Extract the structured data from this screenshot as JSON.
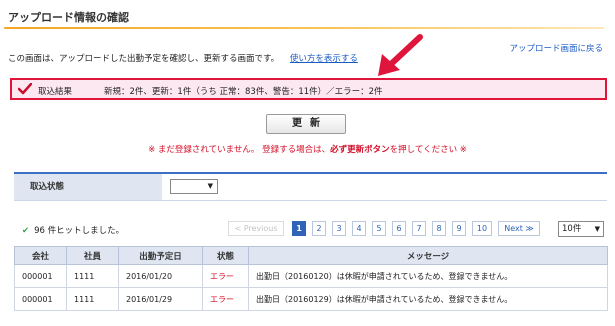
{
  "page": {
    "title": "アップロード情報の確認",
    "back_link": "アップロード画面に戻る",
    "intro_text": "この画面は、アップロードした出勤予定を確認し、更新する画面です。",
    "help_link": "使い方を表示する"
  },
  "result": {
    "label": "取込結果",
    "summary": "新規：2件、更新：1件（うち 正常：83件、警告：11件）／エラー：2件"
  },
  "actions": {
    "update_label": "更新"
  },
  "warning": {
    "prefix": "※ まだ登録されていません。 登録する場合は、",
    "emphasis": "必ず更新ボタン",
    "suffix": "を押してください ※"
  },
  "filter": {
    "label": "取込状態",
    "selected": ""
  },
  "listing": {
    "hit_count": "96 件ヒットしました。",
    "pager": {
      "previous": "< Previous",
      "pages": [
        "1",
        "2",
        "3",
        "4",
        "5",
        "6",
        "7",
        "8",
        "9",
        "10"
      ],
      "current": "1",
      "next": "Next ≫"
    },
    "per_page": "10件"
  },
  "table": {
    "columns": [
      "会社",
      "社員",
      "出勤予定日",
      "状態",
      "メッセージ"
    ],
    "rows": [
      [
        "000001",
        "1111",
        "2016/01/20",
        "エラー",
        "出勤日（20160120）は休暇が申請されているため、登録できません。"
      ],
      [
        "000001",
        "1111",
        "2016/01/29",
        "エラー",
        "出勤日（20160129）は休暇が申請されているため、登録できません。"
      ]
    ]
  },
  "colors": {
    "accent_orange": "#f5a623",
    "error_red": "#d4102a",
    "header_blue": "#dfe6f1",
    "link_blue": "#1a5bc4"
  }
}
